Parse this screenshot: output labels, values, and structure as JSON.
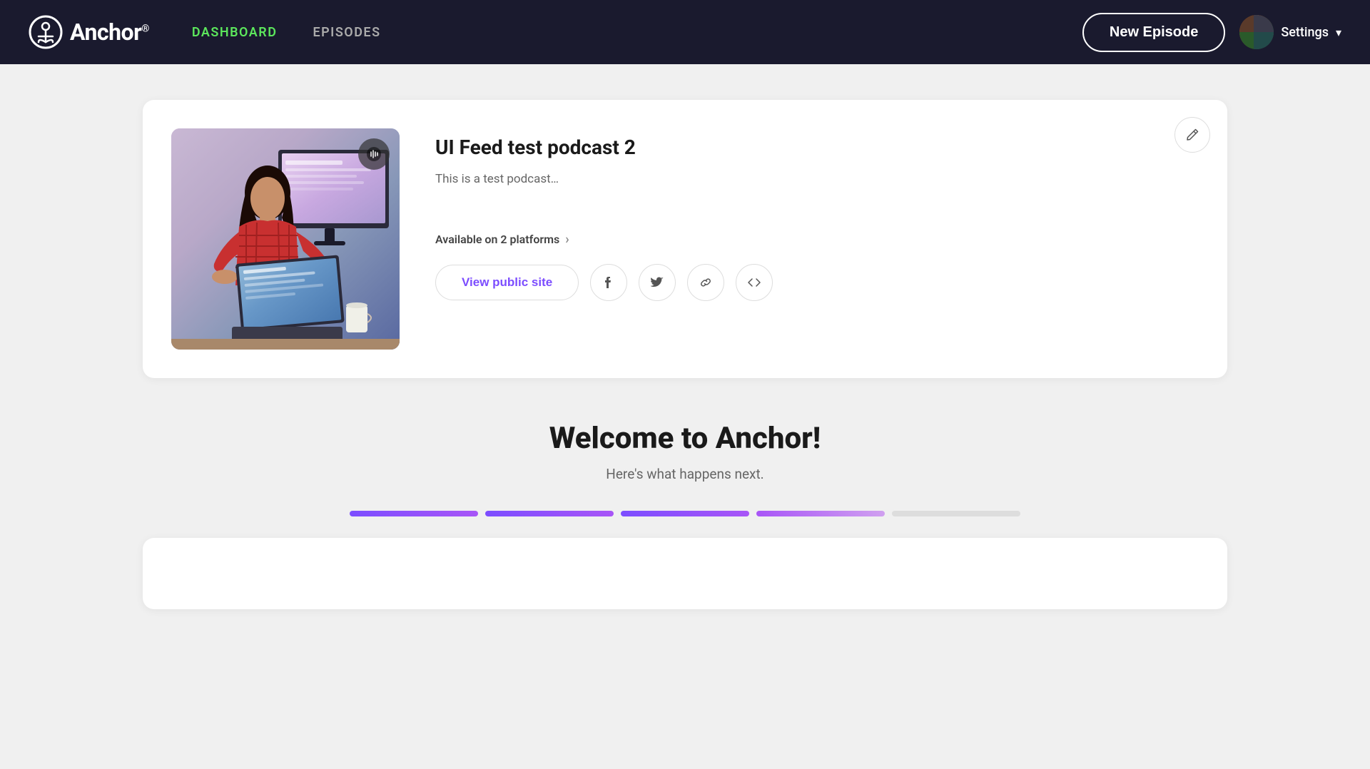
{
  "header": {
    "logo_text": "Anchor",
    "logo_reg": "®",
    "nav": [
      {
        "id": "dashboard",
        "label": "DASHBOARD",
        "active": true
      },
      {
        "id": "episodes",
        "label": "EPISODES",
        "active": false
      }
    ],
    "new_episode_button": "New Episode",
    "settings_label": "Settings",
    "avatar_emoji": "🖼"
  },
  "podcast_card": {
    "title": "UI Feed test podcast 2",
    "description": "This is a test podcast…",
    "platforms_text": "Available on 2 platforms",
    "platforms_arrow": "›",
    "view_public_button": "View public site",
    "social_buttons": [
      {
        "id": "facebook",
        "icon": "facebook"
      },
      {
        "id": "twitter",
        "icon": "twitter"
      },
      {
        "id": "link",
        "icon": "link"
      },
      {
        "id": "embed",
        "icon": "embed"
      }
    ],
    "edit_icon": "✏",
    "audio_icon": "🔊"
  },
  "welcome_section": {
    "title": "Welcome to Anchor!",
    "subtitle": "Here's what happens next.",
    "progress_steps": [
      {
        "id": "step1",
        "state": "completed"
      },
      {
        "id": "step2",
        "state": "completed"
      },
      {
        "id": "step3",
        "state": "completed"
      },
      {
        "id": "step4",
        "state": "partial"
      },
      {
        "id": "step5",
        "state": "inactive"
      }
    ]
  },
  "colors": {
    "header_bg": "#1a1a2e",
    "nav_active": "#5ce65c",
    "accent_purple": "#7c4dff",
    "body_bg": "#f0f0f0"
  }
}
